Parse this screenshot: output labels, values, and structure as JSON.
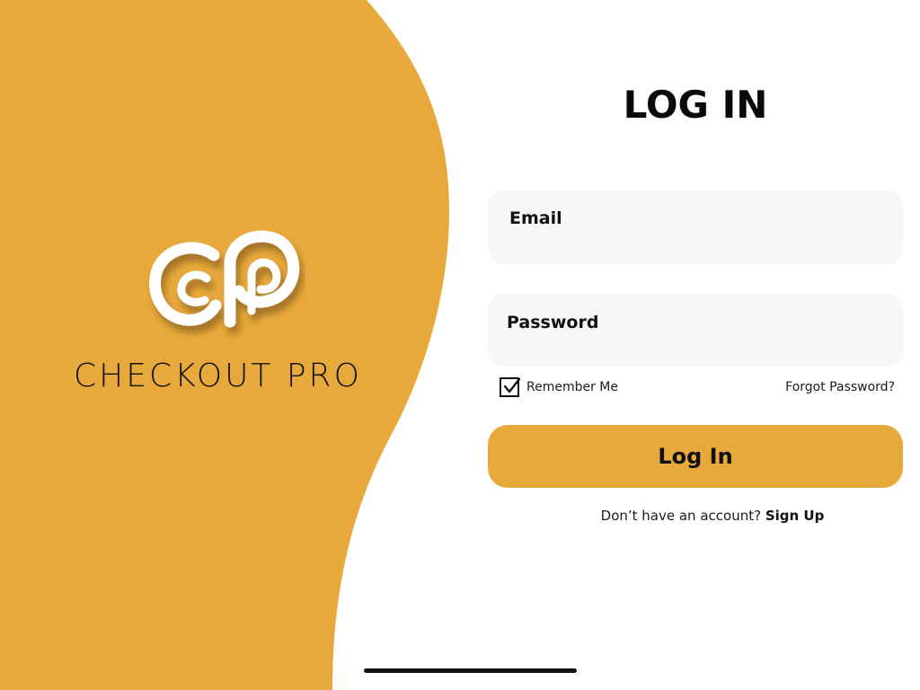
{
  "brand": {
    "name": "CHECKOUT PRO",
    "logo_icon": "cp-monogram-logo",
    "accent_color": "#e8a93c"
  },
  "form": {
    "title": "LOG IN",
    "email": {
      "label": "Email",
      "value": "",
      "placeholder": ""
    },
    "password": {
      "label": "Password",
      "value": "",
      "placeholder": ""
    },
    "remember_me": {
      "label": "Remember Me",
      "checked": true
    },
    "forgot_password_label": "Forgot Password?",
    "submit_label": "Log In",
    "signup_prompt": "Don’t have an account?",
    "signup_link_label": "Sign Up"
  }
}
